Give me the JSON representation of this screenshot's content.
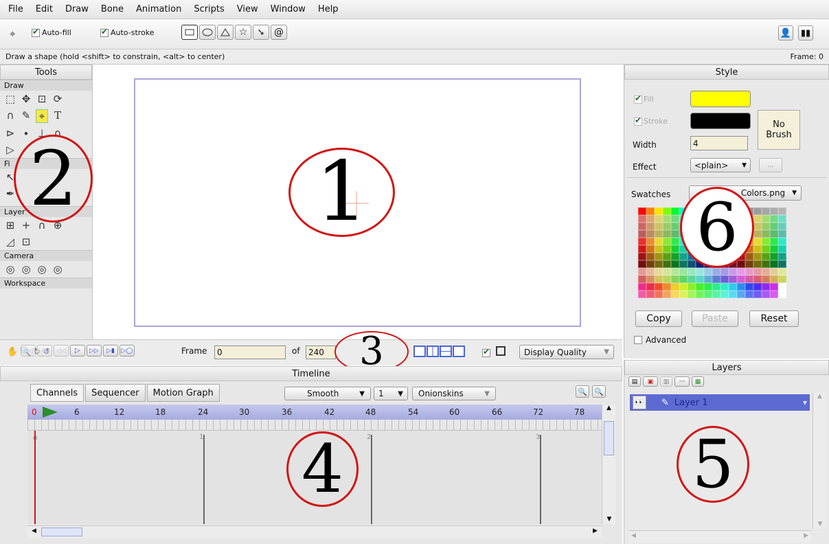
{
  "menu": [
    "File",
    "Edit",
    "Draw",
    "Bone",
    "Animation",
    "Scripts",
    "View",
    "Window",
    "Help"
  ],
  "toolbar": {
    "autofill_label": "Auto-fill",
    "autostroke_label": "Auto-stroke"
  },
  "status": {
    "hint": "Draw a shape (hold <shift> to constrain, <alt> to center)",
    "frame_readout": "Frame: 0"
  },
  "tools": {
    "title": "Tools",
    "groups": [
      {
        "label": "Draw",
        "rows": [
          [
            "⬚",
            "✥",
            "⊡",
            "⟳"
          ],
          [
            "∩",
            "✎",
            "⌖",
            "T"
          ],
          [
            "⊳",
            "∙",
            "⊥",
            "∩"
          ],
          [
            "▷",
            "",
            "",
            ""
          ]
        ]
      },
      {
        "label": "Fi",
        "rows": [
          [
            "↖",
            "",
            "",
            ""
          ],
          [
            "✒",
            "",
            "⌣",
            ""
          ]
        ]
      },
      {
        "label": "Layer",
        "rows": [
          [
            "⊞",
            "+",
            "∩",
            "⊕"
          ],
          [
            "◿",
            "⊡"
          ]
        ]
      },
      {
        "label": "Camera",
        "rows": [
          [
            "◎",
            "◎",
            "◎",
            "◎"
          ]
        ]
      },
      {
        "label": "Workspace",
        "rows": [
          [
            "✋",
            "🔍",
            "↻",
            "↺"
          ]
        ]
      }
    ]
  },
  "annotations": [
    "1",
    "2",
    "3",
    "4",
    "5",
    "6"
  ],
  "playback": {
    "frame_label": "Frame",
    "frame_value": "0",
    "of_label": "of",
    "of_value": "240",
    "display_quality": "Display Quality"
  },
  "timeline": {
    "title": "Timeline",
    "tabs": [
      "Channels",
      "Sequencer",
      "Motion Graph"
    ],
    "interp": "Smooth",
    "step": "1",
    "onion": "Onionskins",
    "ruler": [
      "0",
      "6",
      "12",
      "18",
      "24",
      "30",
      "36",
      "42",
      "48",
      "54",
      "60",
      "66",
      "72",
      "78"
    ],
    "seconds": [
      "0",
      "1",
      "2",
      "3"
    ]
  },
  "style": {
    "title": "Style",
    "fill_label": "Fill",
    "stroke_label": "Stroke",
    "width_label": "Width",
    "width_value": "4",
    "effect_label": "Effect",
    "effect_value": "<plain>",
    "no_brush": "No Brush",
    "swatches_label": "Swatches",
    "swatches_value": "Colors.png",
    "copy": "Copy",
    "paste": "Paste",
    "reset": "Reset",
    "advanced": "Advanced",
    "fill_color": "#ffff00",
    "stroke_color": "#000000"
  },
  "layers": {
    "title": "Layers",
    "items": [
      {
        "name": "Layer 1"
      }
    ]
  }
}
